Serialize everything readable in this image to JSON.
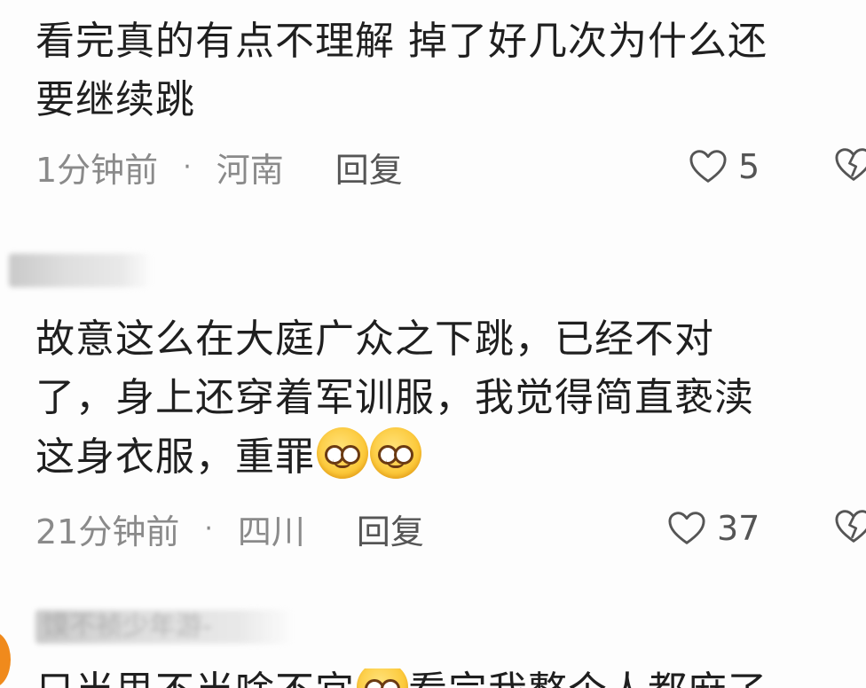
{
  "comments": [
    {
      "text_line1": "看完真的有点不理解 掉了好几次为什么还",
      "text_line2": "要继续跳",
      "time": "1分钟前",
      "dot": "·",
      "location": "河南",
      "reply": "回复",
      "likes": "5"
    },
    {
      "text_line1": "故意这么在大庭广众之下跳，已经不对",
      "text_line2": "了，身上还穿着军训服，我觉得简直亵渎",
      "text_line3": "这身衣服，重罪",
      "time": "21分钟前",
      "dot": "·",
      "location": "四川",
      "reply": "回复",
      "likes": "37"
    },
    {
      "username_partial": "馍不祯少年游-",
      "text_partial": "只当思不当啥不宜",
      "text_partial2": "看完我整个人都麻了"
    }
  ],
  "icons": {
    "like": "heart-outline-icon",
    "dislike": "broken-heart-outline-icon",
    "emoji": "smiling-face-emoji"
  },
  "colors": {
    "text": "#1f1f1f",
    "meta": "#8a8a8a",
    "background": "#fdfdfd"
  }
}
